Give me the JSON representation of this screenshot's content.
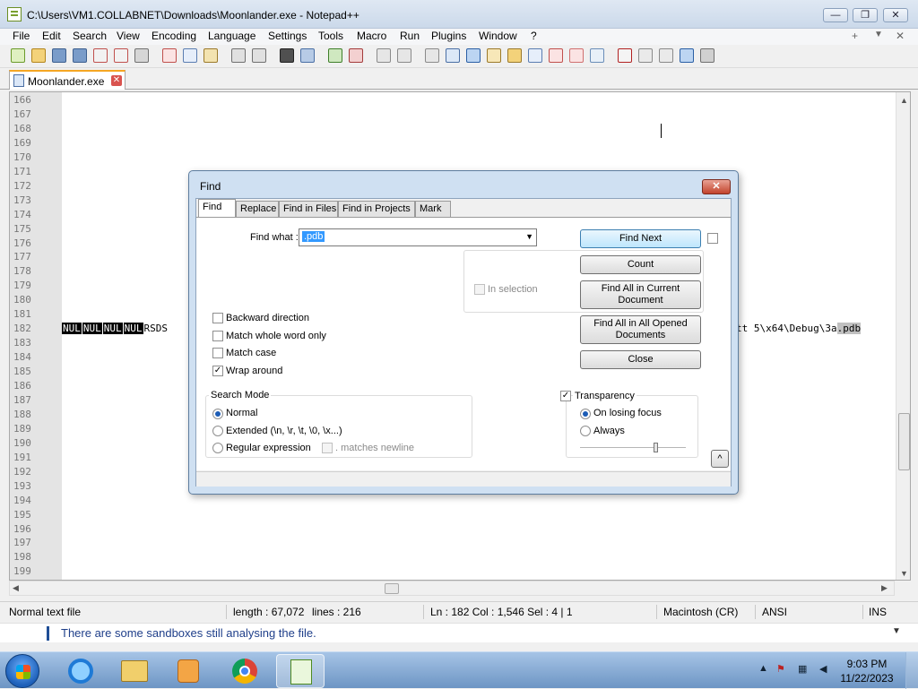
{
  "window": {
    "title": "C:\\Users\\VM1.COLLABNET\\Downloads\\Moonlander.exe - Notepad++",
    "minimize": "—",
    "maximize": "❐",
    "close": "✕"
  },
  "menu": {
    "items": [
      "File",
      "Edit",
      "Search",
      "View",
      "Encoding",
      "Language",
      "Settings",
      "Tools",
      "Macro",
      "Run",
      "Plugins",
      "Window",
      "?"
    ],
    "right_plus": "+",
    "right_down": "▼",
    "right_close": "✕"
  },
  "tab": {
    "label": "Moonlander.exe",
    "close": "✕"
  },
  "editor": {
    "line_numbers": [
      "166",
      "167",
      "168",
      "169",
      "170",
      "171",
      "172",
      "173",
      "174",
      "175",
      "176",
      "177",
      "178",
      "179",
      "180",
      "181",
      "182",
      "183",
      "184",
      "185",
      "186",
      "187",
      "188",
      "189",
      "190",
      "191",
      "192",
      "193",
      "194",
      "195",
      "196",
      "197",
      "198",
      "199"
    ],
    "line182": {
      "ctrl": [
        "NUL",
        "NUL",
        "NUL",
        "NUL"
      ],
      "text": "RSDS",
      "tail": "tt 5\\x64\\Debug\\3a",
      "selected": ".pdb"
    }
  },
  "status": {
    "file_type": "Normal text file",
    "length": "length : 67,072",
    "lines": "lines : 216",
    "position": "Ln : 182    Col : 1,546    Sel : 4 | 1",
    "eol": "Macintosh (CR)",
    "encoding": "ANSI",
    "mode": "INS"
  },
  "notice": {
    "message": "There are some sandboxes still analysing the file."
  },
  "taskbar": {
    "time": "9:03 PM",
    "date": "11/22/2023"
  },
  "find_dialog": {
    "title": "Find",
    "close": "✕",
    "tabs": [
      "Find",
      "Replace",
      "Find in Files",
      "Find in Projects",
      "Mark"
    ],
    "find_what_label": "Find what :",
    "find_what_value": ".pdb",
    "buttons": {
      "find_next": "Find Next",
      "count": "Count",
      "find_all_current": "Find All in Current Document",
      "find_all_opened": "Find All in All Opened Documents",
      "close": "Close"
    },
    "in_selection": "In selection",
    "options": {
      "backward": "Backward direction",
      "whole_word": "Match whole word only",
      "match_case": "Match case",
      "wrap_around": "Wrap around"
    },
    "search_mode": {
      "label": "Search Mode",
      "normal": "Normal",
      "extended": "Extended (\\n, \\r, \\t, \\0, \\x...)",
      "regex": "Regular expression",
      "matches_newline": ". matches newline",
      "selected": "Normal"
    },
    "transparency": {
      "label": "Transparency",
      "on_losing_focus": "On losing focus",
      "always": "Always",
      "enabled": true,
      "selected": "On losing focus",
      "level": 0.72
    },
    "collapse": "^"
  },
  "colors": {
    "selection": "#3399ff",
    "ctrl_char_bg": "#000000",
    "tab_accent": "#f5a623"
  }
}
